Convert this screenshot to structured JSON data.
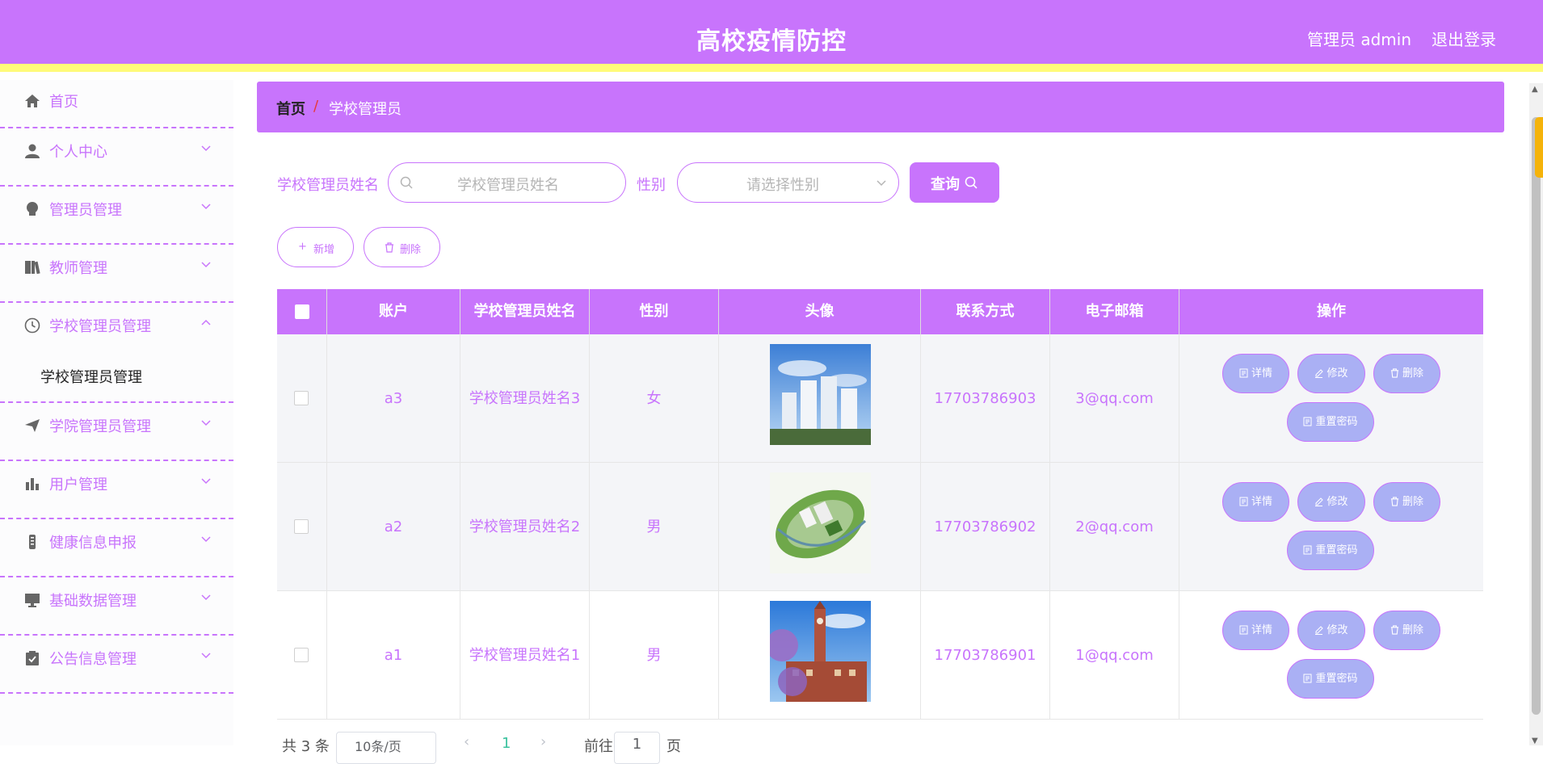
{
  "header": {
    "title": "高校疫情防控",
    "admin": "管理员 admin",
    "logout": "退出登录"
  },
  "sidebar": {
    "items": [
      {
        "label": "首页",
        "icon": "home-icon"
      },
      {
        "label": "个人中心",
        "icon": "user-icon"
      },
      {
        "label": "管理员管理",
        "icon": "bulb-icon"
      },
      {
        "label": "教师管理",
        "icon": "book-icon"
      },
      {
        "label": "学校管理员管理",
        "icon": "clock-icon"
      },
      {
        "label": "学院管理员管理",
        "icon": "send-icon"
      },
      {
        "label": "用户管理",
        "icon": "bar-chart-icon"
      },
      {
        "label": "健康信息申报",
        "icon": "microphone-icon"
      },
      {
        "label": "基础数据管理",
        "icon": "monitor-icon"
      },
      {
        "label": "公告信息管理",
        "icon": "clipboard-icon"
      }
    ],
    "sub_item": "学校管理员管理"
  },
  "breadcrumb": {
    "home": "首页",
    "sep": "/",
    "current": "学校管理员"
  },
  "search": {
    "name_label": "学校管理员姓名",
    "name_placeholder": "学校管理员姓名",
    "gender_label": "性别",
    "gender_placeholder": "请选择性别",
    "query_button": "查询"
  },
  "actions": {
    "add": "新增",
    "delete": "删除"
  },
  "table": {
    "headers": [
      "账户",
      "学校管理员姓名",
      "性别",
      "头像",
      "联系方式",
      "电子邮箱",
      "操作"
    ],
    "rows": [
      {
        "account": "a3",
        "name": "学校管理员姓名3",
        "gender": "女",
        "phone": "17703786903",
        "email": "3@qq.com"
      },
      {
        "account": "a2",
        "name": "学校管理员姓名2",
        "gender": "男",
        "phone": "17703786902",
        "email": "2@qq.com"
      },
      {
        "account": "a1",
        "name": "学校管理员姓名1",
        "gender": "男",
        "phone": "17703786901",
        "email": "1@qq.com"
      }
    ],
    "ops": {
      "detail": "详情",
      "edit": "修改",
      "delete": "删除",
      "reset": "重置密码"
    }
  },
  "pagination": {
    "total": "共 3 条",
    "page_size": "10条/页",
    "current_page": "1",
    "goto": "前往",
    "goto_value": "1",
    "page_unit": "页"
  },
  "colors": {
    "accent": "#c874fc",
    "header_border": "#fffb79",
    "op_button": "#aab0f4"
  }
}
